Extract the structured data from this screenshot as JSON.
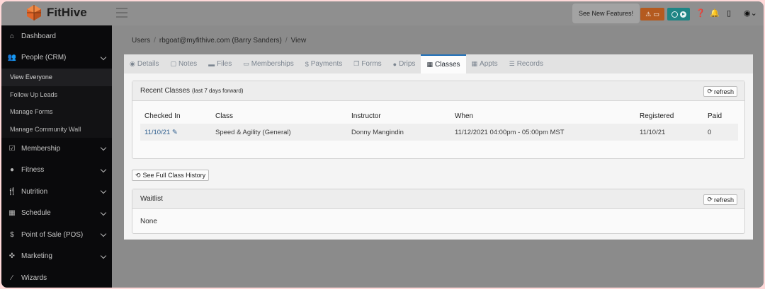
{
  "app": {
    "name": "FitHive",
    "brand_color": "#e0662a"
  },
  "topbar": {
    "features_label": "See New Features!",
    "alert_color": "#b45a1f",
    "timer_color": "#1f8585",
    "icons": [
      "alert-icon",
      "card-icon",
      "timer-icon",
      "play-icon",
      "help-icon",
      "bell-icon",
      "tablet-icon",
      "user-icon",
      "chevron-down-icon"
    ]
  },
  "sidebar": {
    "items": [
      {
        "label": "Dashboard",
        "icon": "home-icon"
      },
      {
        "label": "People (CRM)",
        "icon": "users-icon"
      },
      {
        "label": "View Everyone"
      },
      {
        "label": "Follow Up Leads"
      },
      {
        "label": "Manage Forms"
      },
      {
        "label": "Manage Community Wall"
      },
      {
        "label": "Membership",
        "icon": "checkbox-icon"
      },
      {
        "label": "Fitness",
        "icon": "fitness-icon"
      },
      {
        "label": "Nutrition",
        "icon": "utensils-icon"
      },
      {
        "label": "Schedule",
        "icon": "calendar-icon"
      },
      {
        "label": "Point of Sale (POS)",
        "icon": "dollar-icon"
      },
      {
        "label": "Marketing",
        "icon": "target-icon"
      },
      {
        "label": "Wizards",
        "icon": "wand-icon"
      }
    ]
  },
  "breadcrumb": {
    "items": [
      "Users",
      "rbgoat@myfithive.com (Barry Sanders)",
      "View"
    ]
  },
  "tabs": [
    {
      "label": "Details",
      "icon": "user-circle-icon"
    },
    {
      "label": "Notes",
      "icon": "note-icon"
    },
    {
      "label": "Files",
      "icon": "folder-icon"
    },
    {
      "label": "Memberships",
      "icon": "id-card-icon"
    },
    {
      "label": "Payments",
      "icon": "dollar-icon"
    },
    {
      "label": "Forms",
      "icon": "copy-icon"
    },
    {
      "label": "Drips",
      "icon": "drop-icon"
    },
    {
      "label": "Classes",
      "icon": "calendar-icon"
    },
    {
      "label": "Appts",
      "icon": "calendar-icon"
    },
    {
      "label": "Records",
      "icon": "list-icon"
    }
  ],
  "recent_classes": {
    "title": "Recent Classes",
    "subtitle": "(last 7 days forward)",
    "refresh_label": "refresh",
    "columns": [
      "Checked In",
      "Class",
      "Instructor",
      "When",
      "Registered",
      "Paid"
    ],
    "rows": [
      {
        "checked_in": "11/10/21",
        "class": "Speed & Agility (General)",
        "instructor": "Donny Mangindin",
        "when": "11/12/2021 04:00pm - 05:00pm MST",
        "registered": "11/10/21",
        "paid": "0"
      }
    ]
  },
  "history_button_label": "See Full Class History",
  "waitlist": {
    "title": "Waitlist",
    "refresh_label": "refresh",
    "empty_text": "None"
  }
}
